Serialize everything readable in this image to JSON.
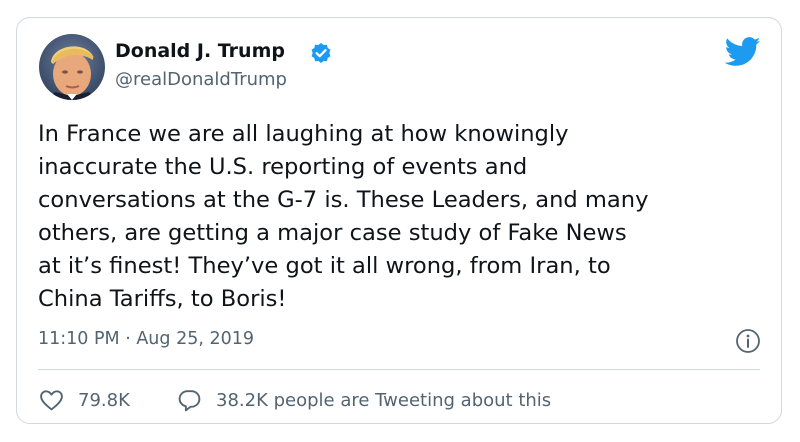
{
  "tweet": {
    "author_name": "Donald J. Trump",
    "handle": "@realDonaldTrump",
    "verified": true,
    "text_lines": [
      "In France we are all laughing at how knowingly",
      "inaccurate the U.S. reporting of events and",
      "conversations at the G-7 is. These Leaders, and many",
      "others, are getting a major case study of Fake News",
      "at it’s finest! They’ve got it all wrong, from Iran, to",
      "China Tariffs, to Boris!"
    ],
    "timestamp": "11:10 PM · Aug 25, 2019",
    "like_count": "79.8K",
    "conversation_text": "38.2K people are Tweeting about this"
  },
  "icons": {
    "verified": "verified-badge-icon",
    "brand": "twitter-bird-icon",
    "info": "info-icon",
    "like": "heart-icon",
    "reply": "speech-bubble-icon"
  },
  "colors": {
    "brand_blue": "#1d9bf0",
    "text_primary": "#0f1419",
    "text_secondary": "#536471",
    "border": "#cfd9de"
  }
}
